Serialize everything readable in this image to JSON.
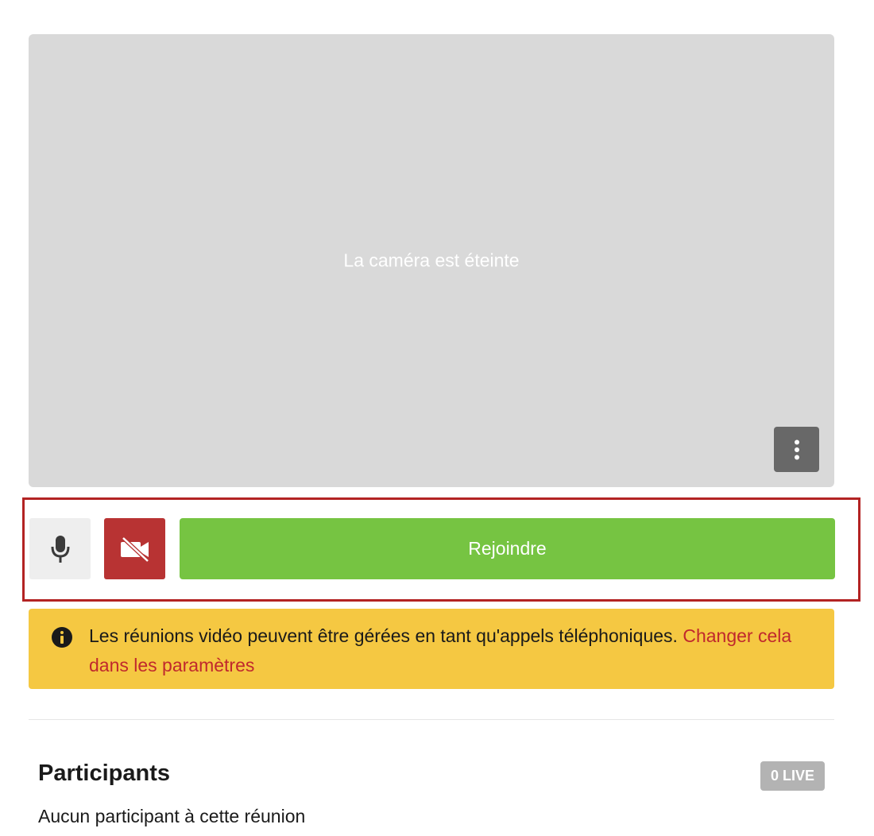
{
  "preview": {
    "message": "La caméra est éteinte",
    "more_icon": "more-vertical-icon"
  },
  "controls": {
    "mic_icon": "microphone-icon",
    "camera_icon": "camera-off-icon",
    "join_label": "Rejoindre"
  },
  "banner": {
    "icon": "info-icon",
    "text": "Les réunions vidéo peuvent être gérées en tant qu'appels téléphoniques. ",
    "link": "Changer cela dans les paramètres"
  },
  "participants": {
    "title": "Participants",
    "badge": "0 LIVE",
    "empty_text": "Aucun participant à cette réunion"
  },
  "colors": {
    "preview_bg": "#d9d9d9",
    "mic_bg": "#eeeeee",
    "camera_off_bg": "#b83333",
    "join_bg": "#76c442",
    "banner_bg": "#f5c842",
    "link": "#c0282d",
    "highlight_border": "#b32323",
    "badge_bg": "#b3b3b3"
  }
}
